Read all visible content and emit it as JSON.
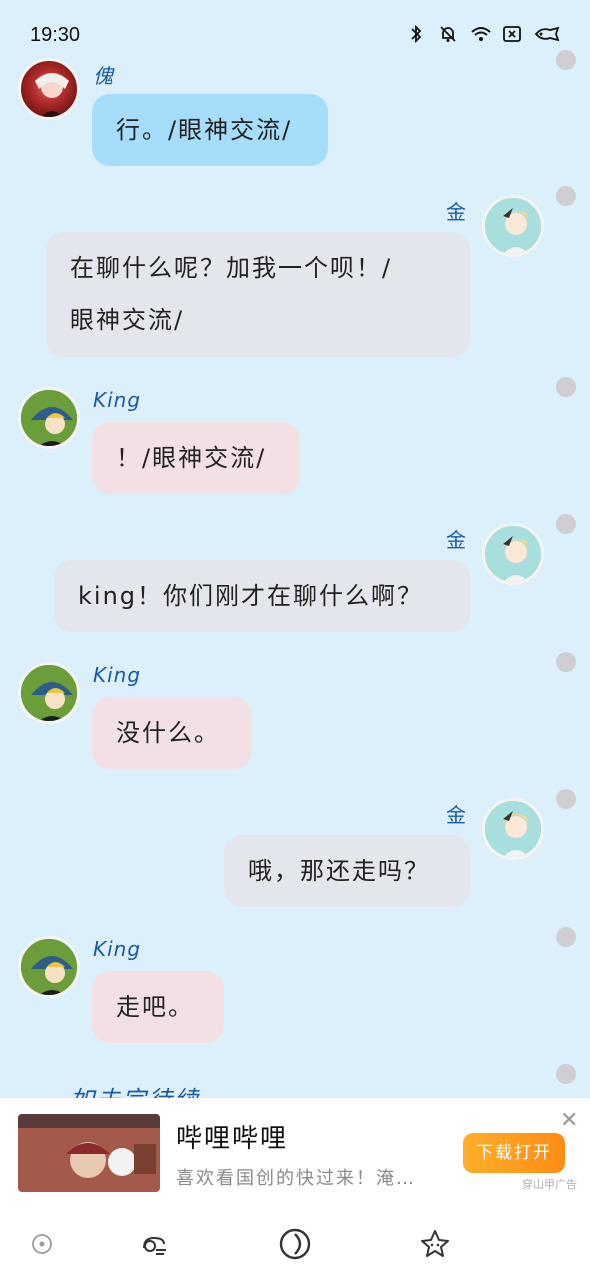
{
  "status_bar": {
    "time": "19:30",
    "icons": [
      "bluetooth-icon",
      "bell-muted-icon",
      "wifi-icon",
      "close-box-icon",
      "battery-icon"
    ]
  },
  "messages": [
    {
      "sender": "傀",
      "text": "行。/眼神交流/",
      "side": "left",
      "bubble_color": "#a6ddfb"
    },
    {
      "sender": "金",
      "text_lines": [
        "在聊什么呢？加我一个呗！/",
        "眼神交流/"
      ],
      "side": "right",
      "bubble_color": "#e3e6ec"
    },
    {
      "sender": "King",
      "text": "！/眼神交流/",
      "side": "left",
      "bubble_color": "#f2e0e4"
    },
    {
      "sender": "金",
      "text": "king！你们刚才在聊什么啊？",
      "side": "right",
      "bubble_color": "#e3e6ec"
    },
    {
      "sender": "King",
      "text": "没什么。",
      "side": "left",
      "bubble_color": "#f2e0e4"
    },
    {
      "sender": "金",
      "text": "哦，那还走吗？",
      "side": "right",
      "bubble_color": "#e3e6ec"
    },
    {
      "sender": "King",
      "text": "走吧。",
      "side": "left",
      "bubble_color": "#f2e0e4"
    }
  ],
  "partial_text": "如未完待续",
  "ad": {
    "title": "哔哩哔哩",
    "subtitle": "喜欢看国创的快过来！淹…",
    "button": "下载打开",
    "tag": "穿山甲广告",
    "close": "✕"
  },
  "bottom_nav": {
    "items": [
      "home-dot-icon",
      "chat-icon",
      "discover-icon",
      "star-icon"
    ]
  },
  "colors": {
    "background": "#dcf0fb",
    "name_blue": "#1a5aa0",
    "button_orange": "#ff8c14"
  }
}
